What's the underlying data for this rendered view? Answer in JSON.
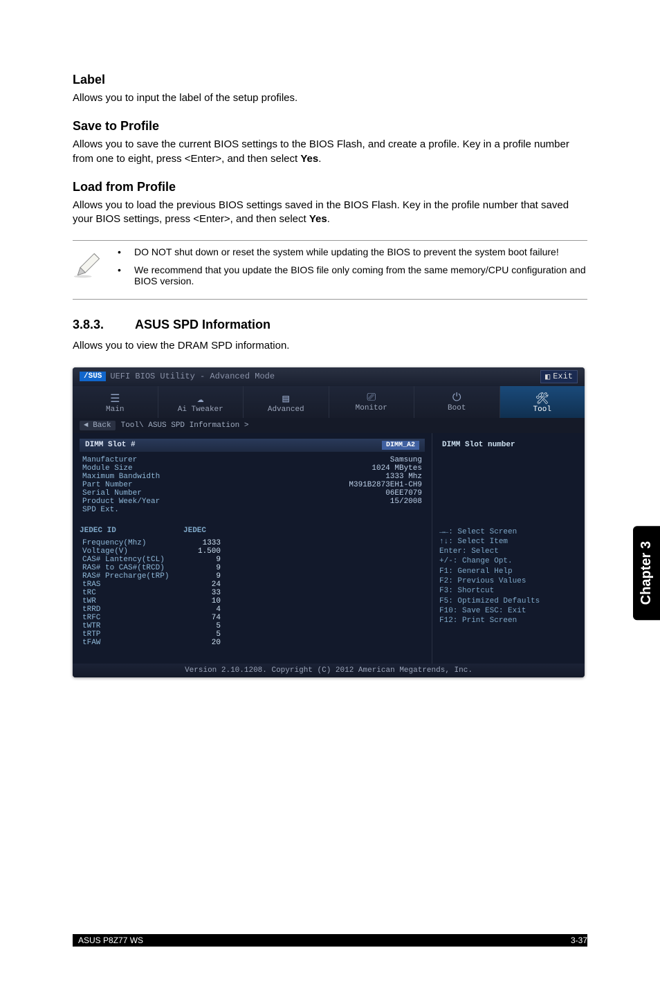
{
  "headings": {
    "label": "Label",
    "save": "Save to Profile",
    "load": "Load from Profile"
  },
  "paragraphs": {
    "label": "Allows you to input the label of the setup profiles.",
    "save_a": "Allows you to save the current BIOS settings to the BIOS Flash, and create a profile. Key in a profile number from one to eight, press <Enter>, and then select ",
    "save_b": "Yes",
    "save_c": ".",
    "load_a": "Allows you to load the previous BIOS settings saved in the BIOS Flash. Key in the profile number that saved your BIOS settings, press <Enter>, and then select ",
    "load_b": "Yes",
    "load_c": "."
  },
  "notes": {
    "n1": "DO NOT shut down or reset the system while updating the BIOS to prevent the system boot failure!",
    "n2": "We recommend that you update the BIOS file only coming from the same memory/CPU configuration and BIOS version."
  },
  "section": {
    "num": "3.8.3.",
    "title": "ASUS SPD Information",
    "desc": "Allows you to view the DRAM SPD information."
  },
  "bios": {
    "topbar_title": "UEFI BIOS Utility - Advanced Mode",
    "asus": "/SUS",
    "exit": "Exit",
    "tabs": [
      "Main",
      "Ai Tweaker",
      "Advanced",
      "Monitor",
      "Boot",
      "Tool"
    ],
    "breadcrumb_back": "Back",
    "breadcrumb_path": "Tool\\ ASUS SPD Information >",
    "slot_label": "DIMM Slot #",
    "slot_badge": "DIMM_A2",
    "right_header": "DIMM Slot number",
    "info": [
      {
        "label": "Manufacturer",
        "val": "Samsung"
      },
      {
        "label": "Module Size",
        "val": "1024 MBytes"
      },
      {
        "label": "Maximum Bandwidth",
        "val": "1333 Mhz"
      },
      {
        "label": "Part Number",
        "val": "M391B2873EH1-CH9"
      },
      {
        "label": "Serial Number",
        "val": "06EE7079"
      },
      {
        "label": "Product Week/Year",
        "val": "15/2008"
      },
      {
        "label": "SPD Ext.",
        "val": ""
      }
    ],
    "jedec_header": {
      "c1": "JEDEC ID",
      "c2": "JEDEC"
    },
    "jedec_rows": [
      {
        "c1": "Frequency(Mhz)",
        "c2": "1333"
      },
      {
        "c1": "Voltage(V)",
        "c2": "1.500"
      },
      {
        "c1": "CAS# Lantency(tCL)",
        "c2": "9"
      },
      {
        "c1": "RAS# to CAS#(tRCD)",
        "c2": "9"
      },
      {
        "c1": "RAS# Precharge(tRP)",
        "c2": "9"
      },
      {
        "c1": "tRAS",
        "c2": "24"
      },
      {
        "c1": "tRC",
        "c2": "33"
      },
      {
        "c1": "tWR",
        "c2": "10"
      },
      {
        "c1": "tRRD",
        "c2": "4"
      },
      {
        "c1": "tRFC",
        "c2": "74"
      },
      {
        "c1": "tWTR",
        "c2": "5"
      },
      {
        "c1": "tRTP",
        "c2": "5"
      },
      {
        "c1": "tFAW",
        "c2": "20"
      }
    ],
    "help": [
      "→←: Select Screen",
      "↑↓: Select Item",
      "Enter: Select",
      "+/-: Change Opt.",
      "F1: General Help",
      "F2: Previous Values",
      "F3: Shortcut",
      "F5: Optimized Defaults",
      "F10: Save  ESC: Exit",
      "F12: Print Screen"
    ],
    "footer": "Version 2.10.1208. Copyright (C) 2012 American Megatrends, Inc."
  },
  "side_tab": "Chapter 3",
  "footer_product": "ASUS P8Z77 WS",
  "footer_page": "3-37"
}
